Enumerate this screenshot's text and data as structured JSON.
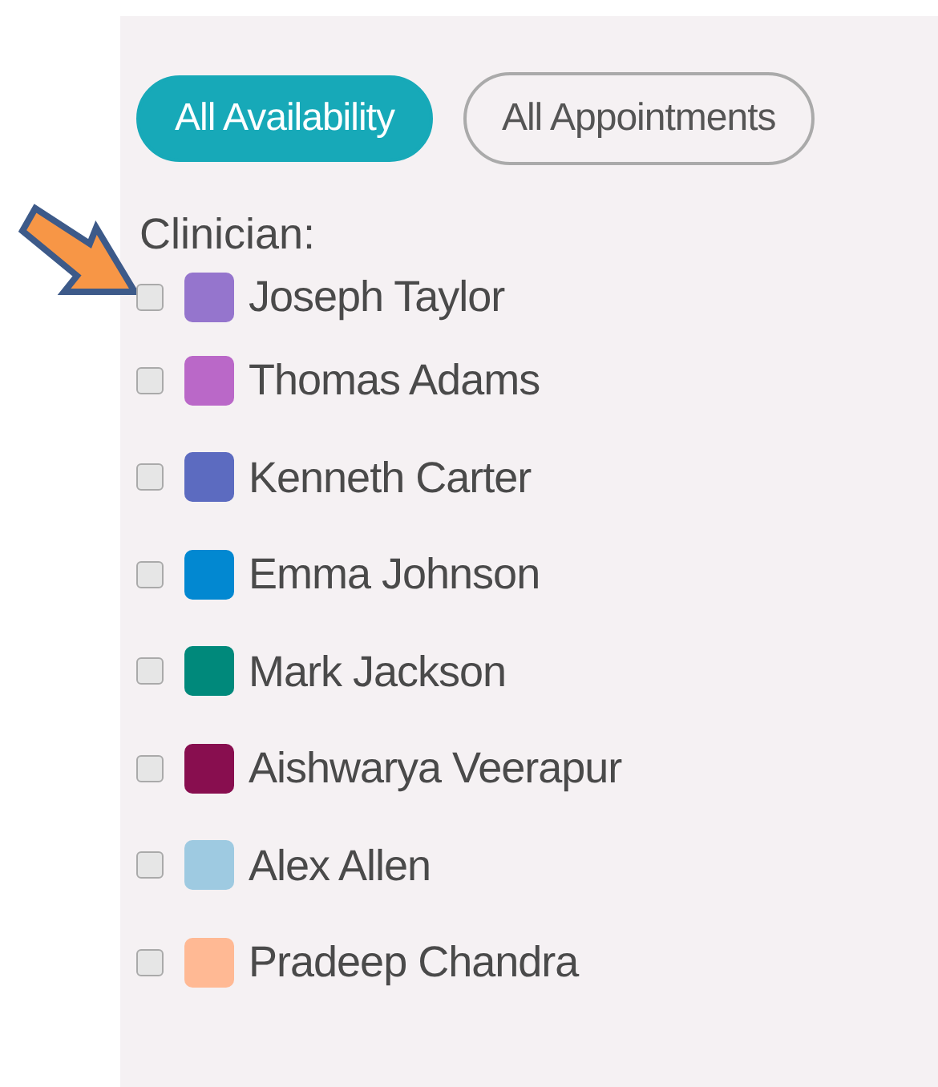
{
  "view_toggle": [
    {
      "label": "All Availability",
      "selected": true
    },
    {
      "label": "All Appointments",
      "selected": false
    }
  ],
  "clinician_filter": {
    "label": "Clinician:",
    "items": [
      {
        "name": "Joseph Taylor",
        "color": "#9575cd",
        "checked": false
      },
      {
        "name": "Thomas Adams",
        "color": "#ba68c8",
        "checked": false
      },
      {
        "name": "Kenneth Carter",
        "color": "#5c6bc0",
        "checked": false
      },
      {
        "name": "Emma Johnson",
        "color": "#0288d1",
        "checked": false
      },
      {
        "name": "Mark Jackson",
        "color": "#00897b",
        "checked": false
      },
      {
        "name": "Aishwarya Veerapur",
        "color": "#880e4f",
        "checked": false
      },
      {
        "name": "Alex Allen",
        "color": "#9ecae1",
        "checked": false
      },
      {
        "name": "Pradeep Chandra",
        "color": "#ffb994",
        "checked": false
      }
    ]
  }
}
